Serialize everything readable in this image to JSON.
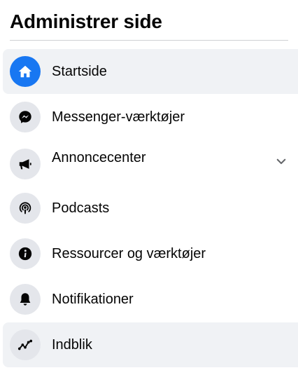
{
  "header": {
    "title": "Administrer side"
  },
  "menu": {
    "items": [
      {
        "label": "Startside",
        "icon": "home-icon"
      },
      {
        "label": "Messenger-værktøjer",
        "icon": "messenger-icon"
      },
      {
        "label": "Annoncecenter",
        "icon": "megaphone-icon"
      },
      {
        "label": "Podcasts",
        "icon": "podcast-icon"
      },
      {
        "label": "Ressourcer og værktøjer",
        "icon": "info-icon"
      },
      {
        "label": "Notifikationer",
        "icon": "bell-icon"
      },
      {
        "label": "Indblik",
        "icon": "insights-icon"
      }
    ]
  },
  "colors": {
    "accent": "#1877f2",
    "icon_bg": "#e4e6eb",
    "selected_bg": "#f0f2f5",
    "text": "#050505"
  }
}
